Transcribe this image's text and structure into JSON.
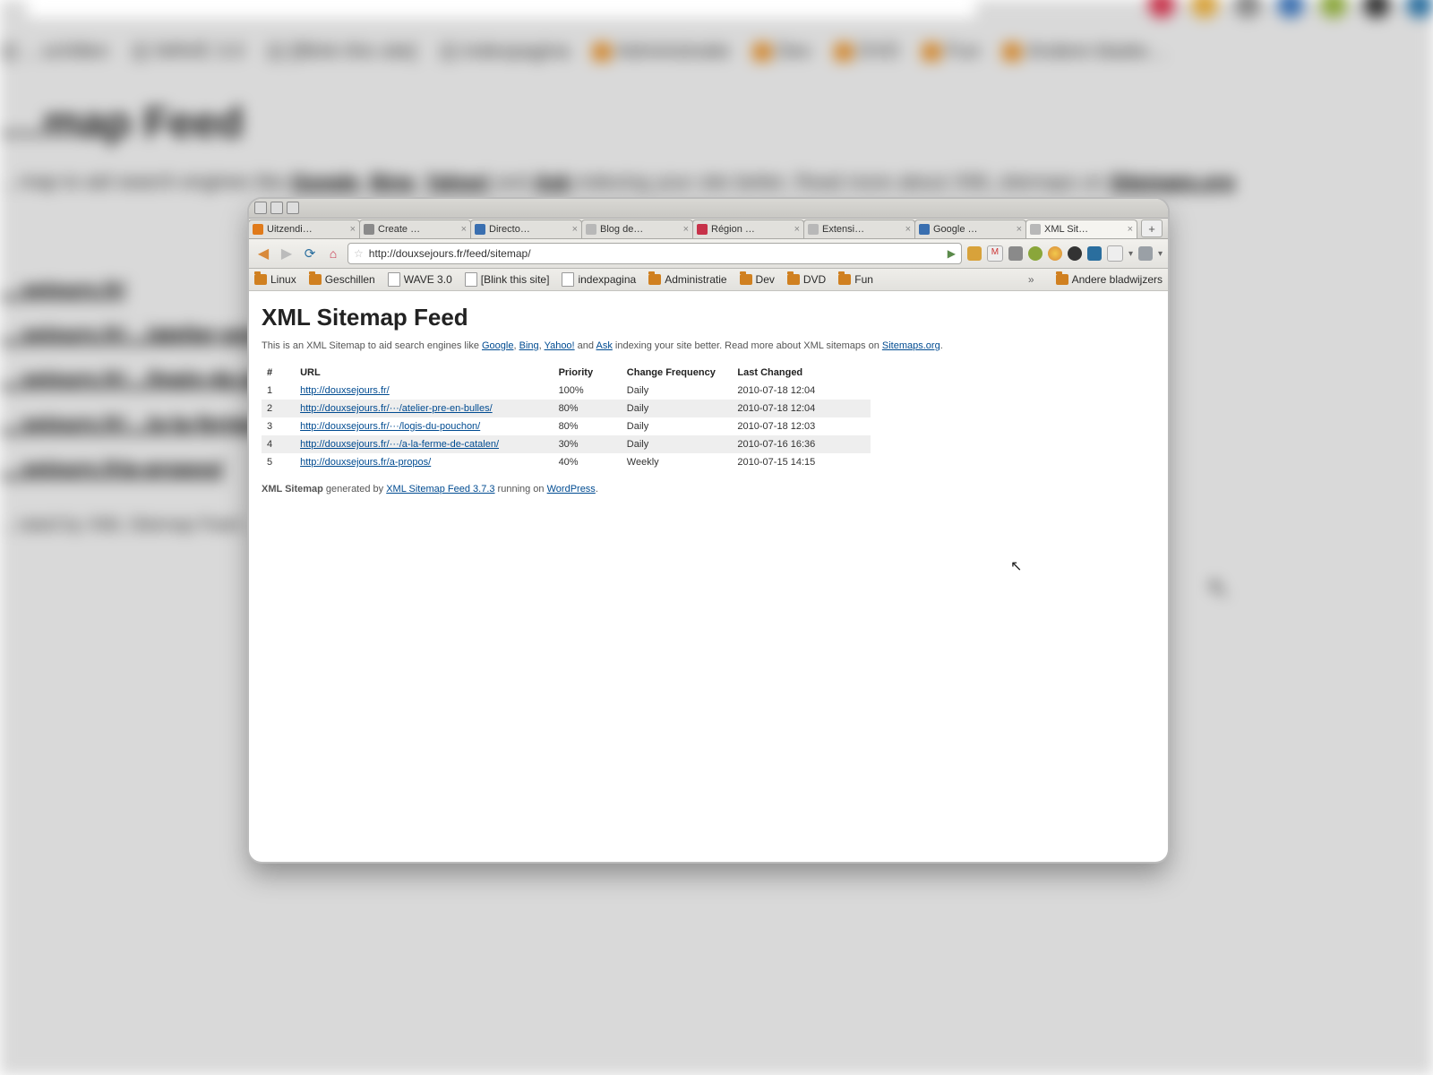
{
  "bg": {
    "heading": "…map Feed",
    "intro_pre": "…map to aid search engines like ",
    "intro_links": [
      "Google",
      "Bing",
      "Yahoo!",
      "Ask"
    ],
    "intro_mid": " indexing your site better. Read more about XML sitemaps on ",
    "intro_end": "Sitemaps.org",
    "bookmarks": [
      "…schillen",
      "WAVE 3.0",
      "[Blink this site]",
      "indexpagina",
      "Administratie",
      "Dev",
      "DVD",
      "Fun",
      "Andere bladw…"
    ],
    "links": [
      "…sejours.fr/",
      "…sejours.fr/…/atelier-pre-en…",
      "…sejours.fr/…/logis-du-pou…",
      "…sejours.fr/…/a-la-ferme-d…",
      "…sejours.fr/a-propos/"
    ],
    "footer": "…rated by XML Sitemap Feed …"
  },
  "window": {
    "tabs": [
      {
        "label": "Uitzendi…",
        "color": "#e07a1a"
      },
      {
        "label": "Create …",
        "color": "#8a8a8a"
      },
      {
        "label": "Directo…",
        "color": "#3a6fb0"
      },
      {
        "label": "Blog de…",
        "color": "#b8b8b8"
      },
      {
        "label": "Région …",
        "color": "#c7324a"
      },
      {
        "label": "Extensi…",
        "color": "#b8b8b8"
      },
      {
        "label": "Google …",
        "color": "#3a6fb0"
      },
      {
        "label": "XML Sit…",
        "color": "#b8b8b8",
        "active": true
      }
    ],
    "newtab": "+",
    "url": "http://douxsejours.fr/feed/sitemap/",
    "bookmarks": [
      {
        "icon": "folder",
        "label": "Linux"
      },
      {
        "icon": "folder",
        "label": "Geschillen"
      },
      {
        "icon": "page",
        "label": "WAVE 3.0"
      },
      {
        "icon": "page",
        "label": "[Blink this site]"
      },
      {
        "icon": "page",
        "label": "indexpagina"
      },
      {
        "icon": "folder",
        "label": "Administratie"
      },
      {
        "icon": "folder",
        "label": "Dev"
      },
      {
        "icon": "folder",
        "label": "DVD"
      },
      {
        "icon": "folder",
        "label": "Fun"
      }
    ],
    "bookbar_overflow": "»",
    "bookbar_right": {
      "icon": "folder",
      "label": "Andere bladwijzers"
    }
  },
  "page": {
    "title": "XML Sitemap Feed",
    "intro_pre": "This is an XML Sitemap to aid search engines like ",
    "intro_links": [
      "Google",
      "Bing",
      "Yahoo!"
    ],
    "intro_and": " and ",
    "intro_ask": "Ask",
    "intro_mid": " indexing your site better. Read more about XML sitemaps on ",
    "intro_end": "Sitemaps.org",
    "cols": [
      "#",
      "URL",
      "Priority",
      "Change Frequency",
      "Last Changed"
    ],
    "rows": [
      {
        "n": "1",
        "url": "http://douxsejours.fr/",
        "pri": "100%",
        "freq": "Daily",
        "last": "2010-07-18 12:04"
      },
      {
        "n": "2",
        "url": "http://douxsejours.fr/···/atelier-pre-en-bulles/",
        "pri": "80%",
        "freq": "Daily",
        "last": "2010-07-18 12:04"
      },
      {
        "n": "3",
        "url": "http://douxsejours.fr/···/logis-du-pouchon/",
        "pri": "80%",
        "freq": "Daily",
        "last": "2010-07-18 12:03"
      },
      {
        "n": "4",
        "url": "http://douxsejours.fr/···/a-la-ferme-de-catalen/",
        "pri": "30%",
        "freq": "Daily",
        "last": "2010-07-16 16:36"
      },
      {
        "n": "5",
        "url": "http://douxsejours.fr/a-propos/",
        "pri": "40%",
        "freq": "Weekly",
        "last": "2010-07-15 14:15"
      }
    ],
    "gen_pre_bold": "XML Sitemap",
    "gen_mid1": " generated by ",
    "gen_link1": "XML Sitemap Feed 3.7.3",
    "gen_mid2": " running on ",
    "gen_link2": "WordPress",
    "gen_end": "."
  },
  "colors": {
    "tb": [
      "#d8a23a",
      "#c94f2d",
      "#8aa63a",
      "#4aa3d8",
      "#333333",
      "#2a6e9e",
      "#9aa0a6"
    ]
  }
}
